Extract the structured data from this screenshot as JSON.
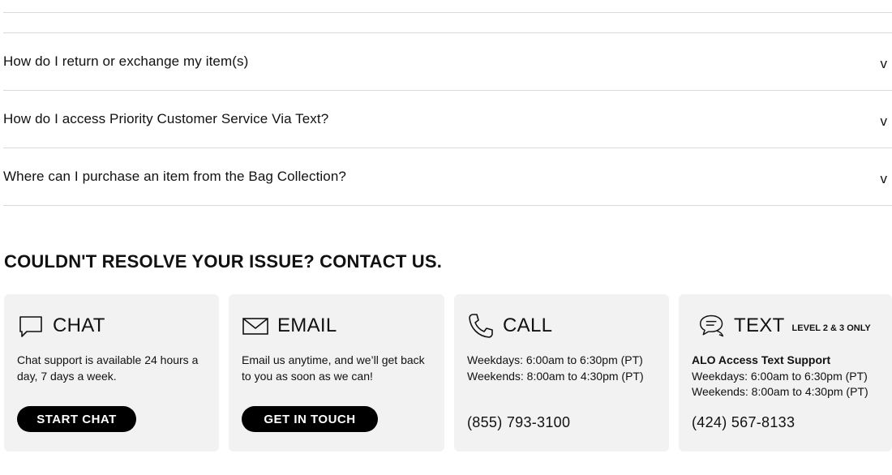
{
  "faq": {
    "items": [
      {
        "question": "How do I return or exchange my item(s)",
        "toggle": "v"
      },
      {
        "question": "How do I access Priority Customer Service Via Text?",
        "toggle": "v"
      },
      {
        "question": "Where can I purchase an item from the Bag Collection?",
        "toggle": "v"
      }
    ]
  },
  "contact": {
    "title": "COULDN'T RESOLVE YOUR ISSUE? CONTACT US.",
    "chat": {
      "icon": "chat-bubble-icon",
      "title": "CHAT",
      "description": "Chat support is available 24 hours a day, 7 days a week.",
      "button": "START CHAT"
    },
    "email": {
      "icon": "envelope-icon",
      "title": "EMAIL",
      "description": "Email us anytime, and we’ll get back to you as soon as we can!",
      "button": "GET IN TOUCH"
    },
    "call": {
      "icon": "phone-icon",
      "title": "CALL",
      "line1": "Weekdays: 6:00am to 6:30pm (PT)",
      "line2": "Weekends: 8:00am to 4:30pm (PT)",
      "phone": "(855) 793-3100"
    },
    "text": {
      "icon": "speech-bubbles-icon",
      "title": "TEXT",
      "subtitle": "LEVEL 2 & 3 ONLY",
      "heading": "ALO Access Text Support",
      "line1": "Weekdays: 6:00am to 6:30pm (PT)",
      "line2": "Weekends: 8:00am to 4:30pm (PT)",
      "phone": "(424) 567-8133"
    }
  }
}
